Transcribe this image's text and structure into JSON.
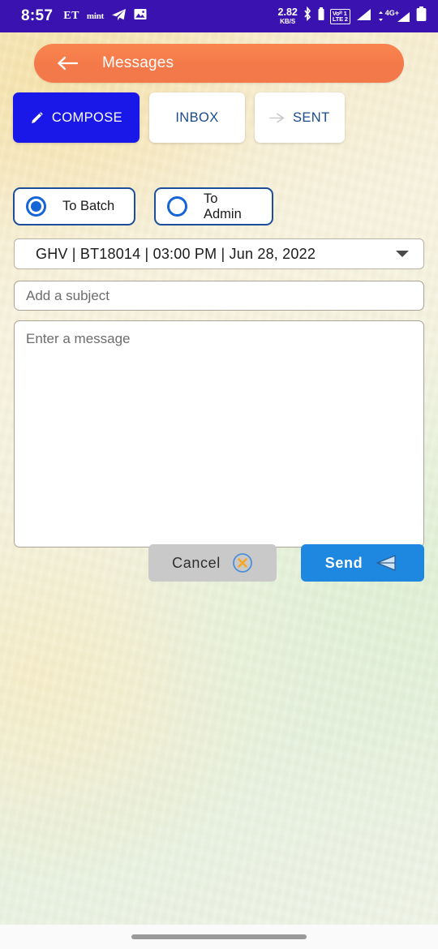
{
  "status_bar": {
    "time": "8:57",
    "notifications": [
      {
        "name": "et-notification-icon",
        "label": "ET"
      },
      {
        "name": "mint-notification-icon",
        "label": "mint"
      },
      {
        "name": "telegram-notification-icon",
        "label": ""
      },
      {
        "name": "gallery-notification-icon",
        "label": ""
      }
    ],
    "network_rate": "2.82",
    "network_rate_unit": "KB/S",
    "bluetooth_icon": "bluetooth-icon",
    "volte_line1": "Voᴿ 1",
    "volte_line2": "LTE 2",
    "signal_icon": "signal-bars-icon",
    "network_type": "4G+",
    "battery_icon": "battery-full-icon",
    "background_color": "#3A12B0"
  },
  "header": {
    "title": "Messages",
    "back_icon": "back-arrow-icon",
    "accent_color": "#F4794A"
  },
  "tabs": [
    {
      "label": "COMPOSE",
      "icon": "pencil-icon",
      "active": true
    },
    {
      "label": "INBOX",
      "icon": "",
      "active": false
    },
    {
      "label": "SENT",
      "icon": "send-arrow-icon",
      "active": false
    }
  ],
  "recipient_options": [
    {
      "label": "To Batch",
      "selected": true
    },
    {
      "label": "To Admin",
      "selected": false
    }
  ],
  "batch_dropdown": {
    "value": "GHV  |  BT18014  |  03:00 PM  |  Jun 28, 2022",
    "caret_icon": "chevron-down-icon"
  },
  "subject": {
    "value": "",
    "placeholder": "Add a subject"
  },
  "message": {
    "value": "",
    "placeholder": "Enter a message"
  },
  "actions": {
    "cancel_label": "Cancel",
    "cancel_icon": "close-circle-icon",
    "send_label": "Send",
    "send_icon": "paper-plane-icon"
  },
  "colors": {
    "compose_blue": "#1A18E8",
    "send_blue": "#1E88E0",
    "cancel_gray": "#C9C9C9",
    "radio_blue": "#1565D8",
    "header_orange": "#F4794A",
    "cancel_icon_orange": "#F5A623"
  }
}
